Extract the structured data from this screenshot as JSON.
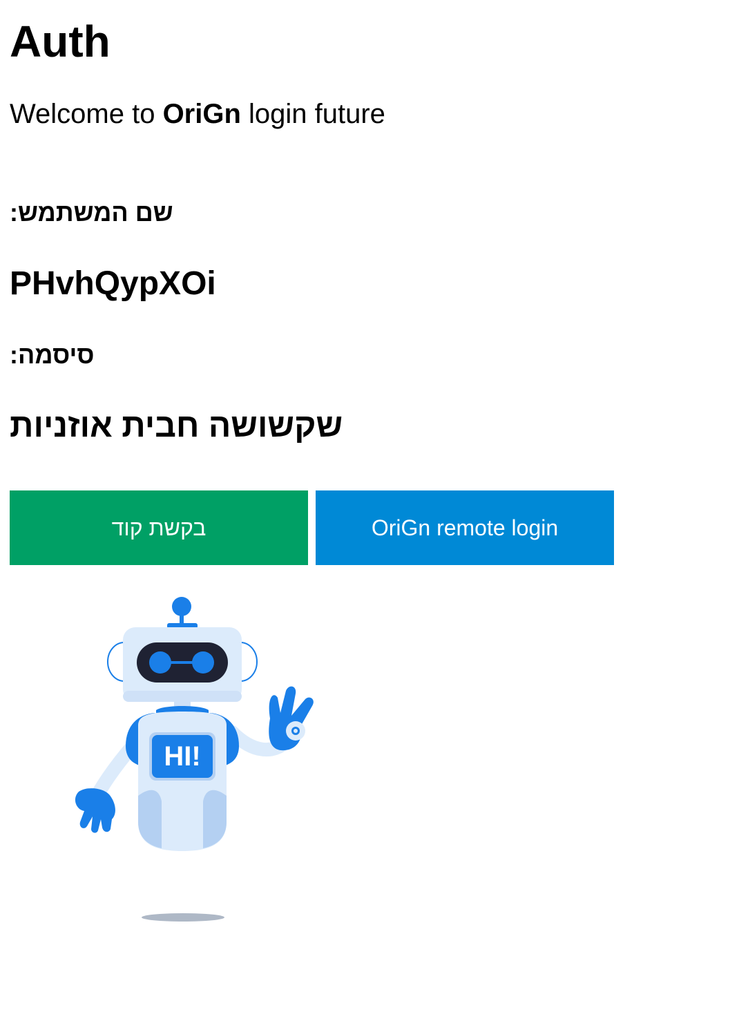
{
  "header": {
    "title": "Auth"
  },
  "welcome": {
    "prefix": "Welcome to ",
    "brand": "OriGn",
    "suffix": " login future"
  },
  "credentials": {
    "username_label": "שם המשתמש:",
    "username_value": "PHvhQypXOi",
    "password_label": "סיסמה:",
    "password_value": "שקשושה חבית אוזניות"
  },
  "actions": {
    "request_code_label": "בקשת קוד",
    "remote_login_label": "OriGn remote login"
  },
  "illustration": {
    "badge_text": "HI!",
    "icon": "robot-waving-icon"
  },
  "colors": {
    "request_button": "#00a065",
    "remote_button": "#0089d6",
    "robot_blue": "#1a7fe8",
    "robot_light": "#dcebfb"
  }
}
